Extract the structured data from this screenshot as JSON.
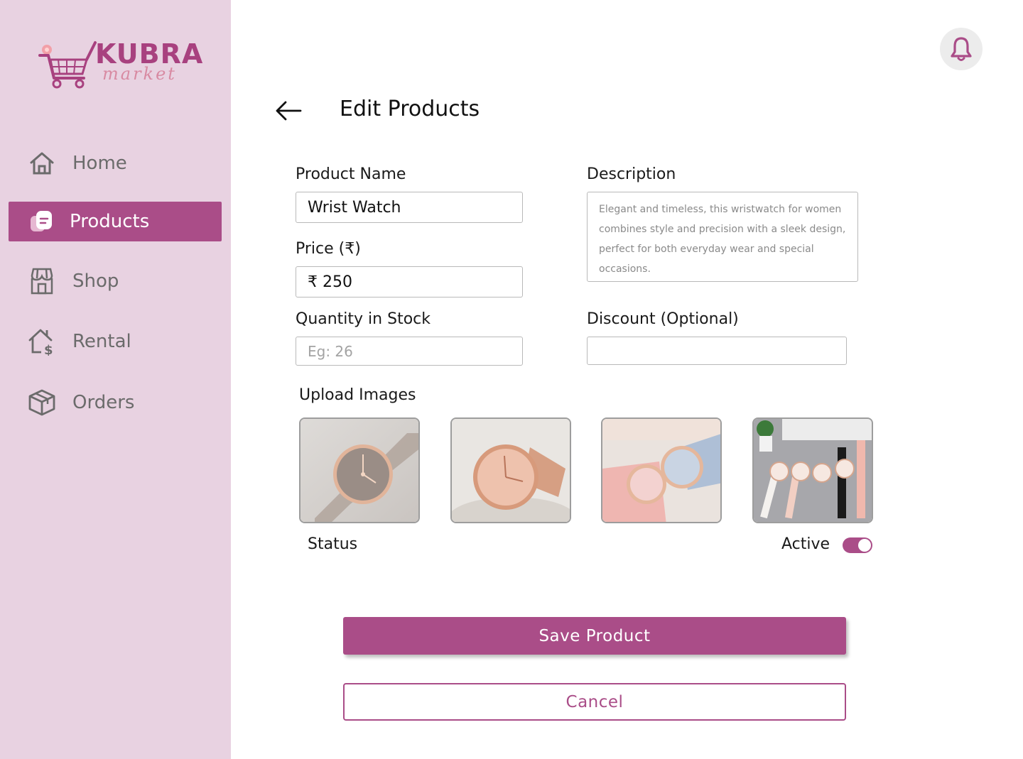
{
  "brand": {
    "name": "KUBRA",
    "tagline": "market"
  },
  "sidebar": {
    "items": [
      {
        "label": "Home",
        "icon": "home-icon",
        "active": false
      },
      {
        "label": "Products",
        "icon": "products-icon",
        "active": true
      },
      {
        "label": "Shop",
        "icon": "shop-icon",
        "active": false
      },
      {
        "label": "Rental",
        "icon": "rental-icon",
        "active": false
      },
      {
        "label": "Orders",
        "icon": "orders-icon",
        "active": false
      }
    ]
  },
  "header": {
    "title": "Edit Products",
    "back_icon": "arrow-left-icon",
    "notification_icon": "bell-icon"
  },
  "form": {
    "product_name": {
      "label": "Product Name",
      "value": "Wrist Watch"
    },
    "price": {
      "label": "Price (₹)",
      "value": "₹ 250"
    },
    "quantity": {
      "label": "Quantity in Stock",
      "placeholder": "Eg: 26"
    },
    "description": {
      "label": "Description",
      "value": "Elegant and timeless, this wristwatch for women combines style and precision with a sleek design, perfect for both everyday wear and special occasions."
    },
    "discount": {
      "label": "Discount (Optional)",
      "value": ""
    },
    "upload": {
      "label": "Upload Images",
      "images": [
        "watch-image-1",
        "watch-image-2",
        "watch-image-3",
        "watch-image-4"
      ]
    },
    "status": {
      "label": "Status",
      "state_label": "Active",
      "enabled": true
    }
  },
  "actions": {
    "save_label": "Save Product",
    "cancel_label": "Cancel"
  },
  "colors": {
    "accent": "#aa4d88",
    "sidebar_bg": "#e8d2e1"
  }
}
